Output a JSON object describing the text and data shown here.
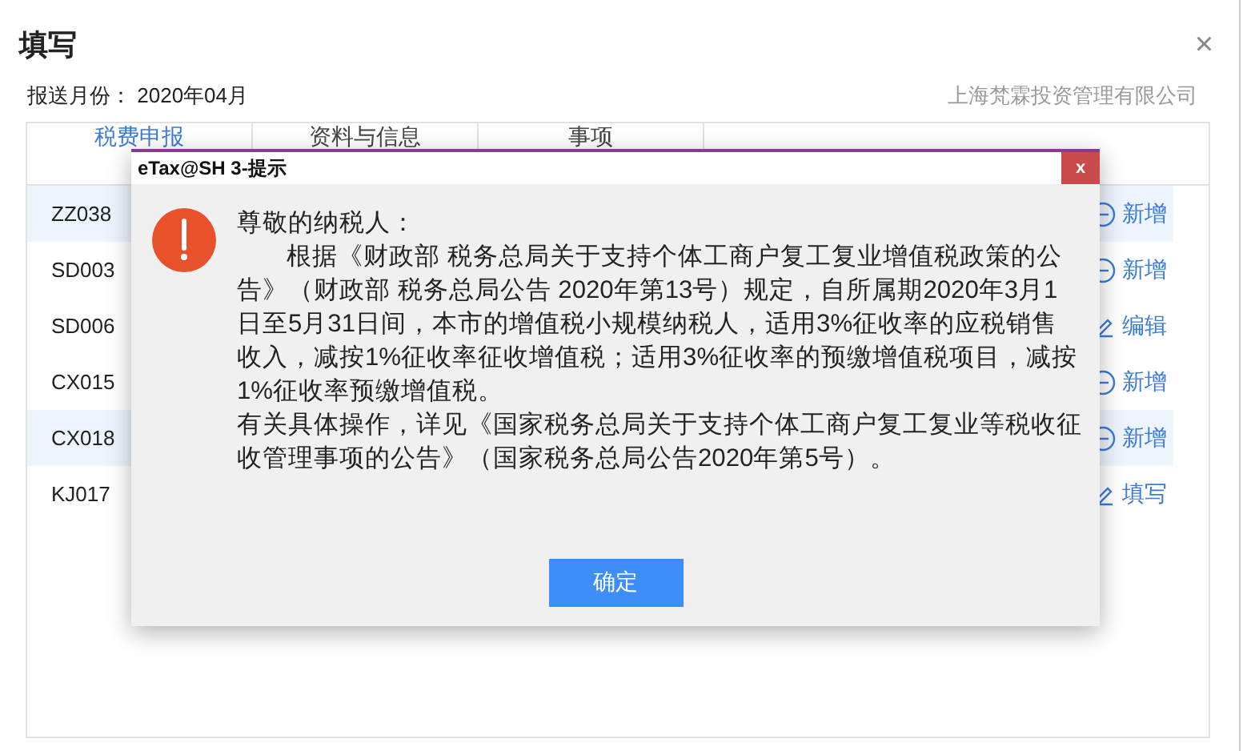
{
  "window": {
    "title": "填写",
    "close": "×"
  },
  "report_month": {
    "label": "报送月份：",
    "value": "2020年04月"
  },
  "company": "上海梵霖投资管理有限公司",
  "tabs": [
    {
      "label": "税费申报",
      "selected": true
    },
    {
      "label": "资料与信息",
      "selected": false
    },
    {
      "label": "事项",
      "selected": false
    }
  ],
  "rows": [
    {
      "code": "ZZ038",
      "highlighted": true,
      "action": {
        "kind": "add",
        "label": "新增"
      }
    },
    {
      "code": "SD003",
      "highlighted": false,
      "action": {
        "kind": "add",
        "label": "新增"
      }
    },
    {
      "code": "SD006",
      "highlighted": false,
      "action": {
        "kind": "edit",
        "label": "编辑"
      }
    },
    {
      "code": "CX015",
      "highlighted": false,
      "action": {
        "kind": "add",
        "label": "新增"
      }
    },
    {
      "code": "CX018",
      "highlighted": true,
      "action": {
        "kind": "add",
        "label": "新增"
      }
    },
    {
      "code": "KJ017",
      "highlighted": false,
      "action": {
        "kind": "edit",
        "label": "填写"
      }
    }
  ],
  "dialog": {
    "title": "eTax@SH 3-提示",
    "close": "x",
    "greeting": "尊敬的纳税人：",
    "paragraphs": [
      "根据《财政部 税务总局关于支持个体工商户复工复业增值税政策的公告》（财政部 税务总局公告 2020年第13号）规定，自所属期2020年3月1日至5月31日间，本市的增值税小规模纳税人，适用3%征收率的应税销售收入，减按1%征收率征收增值税；适用3%征收率的预缴增值税项目，减按1%征收率预缴增值税。",
      "有关具体操作，详见《国家税务总局关于支持个体工商户复工复业等税收征收管理事项的公告》（国家税务总局公告2020年第5号）。"
    ],
    "button": "确定"
  }
}
